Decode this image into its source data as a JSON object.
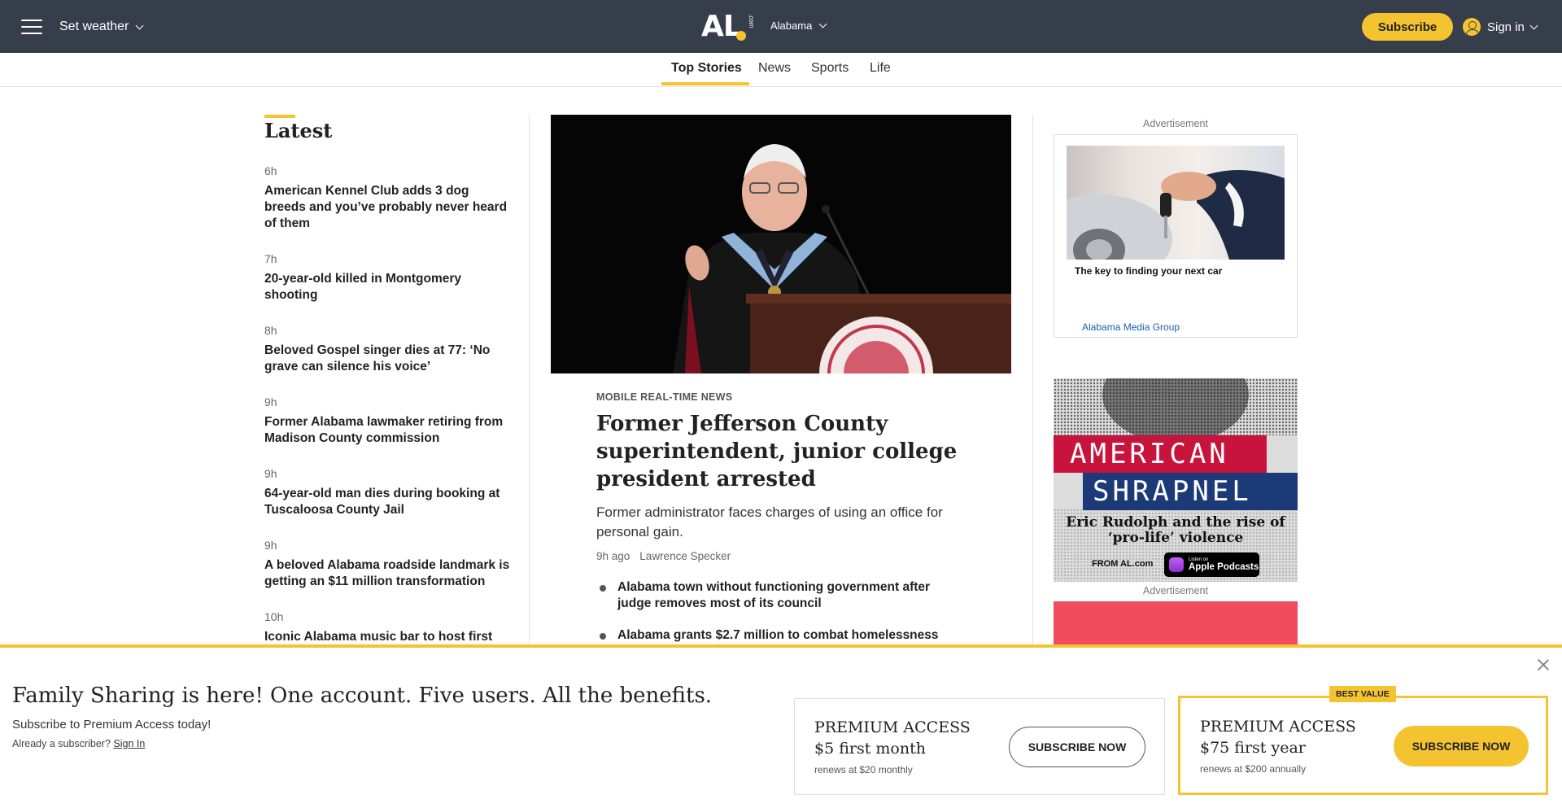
{
  "header": {
    "weather_label": "Set weather",
    "logo_text": "AL",
    "logo_com": ".com",
    "region": "Alabama",
    "subscribe_label": "Subscribe",
    "signin_label": "Sign in"
  },
  "nav": {
    "tabs": [
      {
        "label": "Top Stories",
        "active": true
      },
      {
        "label": "News"
      },
      {
        "label": "Sports"
      },
      {
        "label": "Life"
      }
    ]
  },
  "latest": {
    "title": "Latest",
    "items": [
      {
        "time": "6h",
        "headline": "American Kennel Club adds 3 dog breeds and you’ve probably never heard of them"
      },
      {
        "time": "7h",
        "headline": "20-year-old killed in Montgomery shooting"
      },
      {
        "time": "8h",
        "headline": "Beloved Gospel singer dies at 77: ‘No grave can silence his voice’"
      },
      {
        "time": "9h",
        "headline": "Former Alabama lawmaker retiring from Madison County commission"
      },
      {
        "time": "9h",
        "headline": "64-year-old man dies during booking at Tuscaloosa County Jail"
      },
      {
        "time": "9h",
        "headline": "A beloved Alabama roadside landmark is getting an $11 million transformation"
      },
      {
        "time": "10h",
        "headline": "Iconic Alabama music bar to host first"
      }
    ]
  },
  "main_story": {
    "label": "MOBILE REAL-TIME NEWS",
    "title": "Former Jefferson County superintendent, junior college president arrested",
    "dek": "Former administrator faces charges of using an office for personal gain.",
    "time": "9h ago",
    "author": "Lawrence Specker",
    "related": [
      "Alabama town without functioning government after judge removes most of its council",
      "Alabama grants $2.7 million to combat homelessness"
    ]
  },
  "ads": {
    "label": "Advertisement",
    "ad1": {
      "title": "The key to finding your next car",
      "sponsor": "Alabama Media Group"
    },
    "ad2": {
      "line1": "AMERICAN",
      "line2": "SHRAPNEL",
      "subtitle": "Eric Rudolph and the rise of ‘pro-life’ violence",
      "from": "FROM AL.com",
      "apple_small": "Listen on",
      "apple_big": "Apple Podcasts"
    }
  },
  "paywall": {
    "title": "Family Sharing is here! One account. Five users. All the benefits.",
    "subtitle": "Subscribe to Premium Access today!",
    "already": "Already a subscriber?",
    "signin": "Sign In",
    "plans": [
      {
        "name": "PREMIUM ACCESS",
        "price": "$5 first month",
        "renews": "renews at $20 monthly",
        "cta": "SUBSCRIBE NOW"
      },
      {
        "name": "PREMIUM ACCESS",
        "price": "$75 first year",
        "renews": "renews at $200 annually",
        "cta": "SUBSCRIBE NOW",
        "badge": "BEST VALUE"
      }
    ]
  },
  "colors": {
    "topbar": "#373e4b",
    "accent": "#f4c430"
  }
}
